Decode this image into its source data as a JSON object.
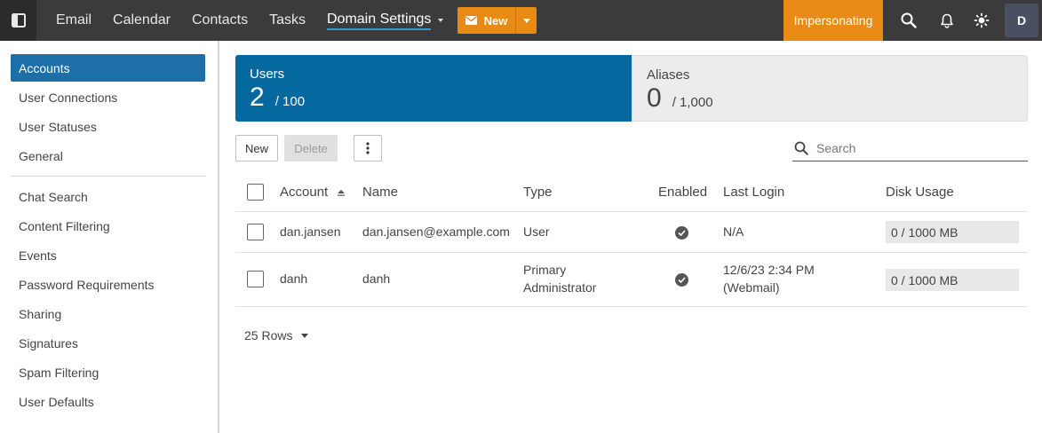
{
  "topbar": {
    "nav": [
      {
        "label": "Email"
      },
      {
        "label": "Calendar"
      },
      {
        "label": "Contacts"
      },
      {
        "label": "Tasks"
      },
      {
        "label": "Domain Settings"
      }
    ],
    "new_label": "New",
    "impersonating_label": "Impersonating",
    "avatar_initial": "D",
    "accent_color": "#e88a14"
  },
  "sidebar": {
    "items": [
      {
        "label": "Accounts"
      },
      {
        "label": "User Connections"
      },
      {
        "label": "User Statuses"
      },
      {
        "label": "General"
      },
      {
        "label": "Chat Search"
      },
      {
        "label": "Content Filtering"
      },
      {
        "label": "Events"
      },
      {
        "label": "Password Requirements"
      },
      {
        "label": "Sharing"
      },
      {
        "label": "Signatures"
      },
      {
        "label": "Spam Filtering"
      },
      {
        "label": "User Defaults"
      }
    ],
    "active_color": "#1d6fa8"
  },
  "stats": {
    "users": {
      "title": "Users",
      "count": "2",
      "limit": "/ 100"
    },
    "aliases": {
      "title": "Aliases",
      "count": "0",
      "limit": "/ 1,000"
    }
  },
  "toolbar": {
    "new_label": "New",
    "delete_label": "Delete",
    "search_placeholder": "Search"
  },
  "table": {
    "columns": {
      "account": "Account",
      "name": "Name",
      "type": "Type",
      "enabled": "Enabled",
      "last_login": "Last Login",
      "disk_usage": "Disk Usage"
    },
    "rows": [
      {
        "account": "dan.jansen",
        "name": "dan.jansen@example.com",
        "type_line1": "User",
        "type_line2": "",
        "enabled": true,
        "last_login_line1": "N/A",
        "last_login_line2": "",
        "disk": "0 / 1000 MB"
      },
      {
        "account": "danh",
        "name": "danh",
        "type_line1": "Primary",
        "type_line2": "Administrator",
        "enabled": true,
        "last_login_line1": "12/6/23 2:34 PM",
        "last_login_line2": "(Webmail)",
        "disk": "0 / 1000 MB"
      }
    ]
  },
  "pagination": {
    "rows_label": "25 Rows"
  }
}
